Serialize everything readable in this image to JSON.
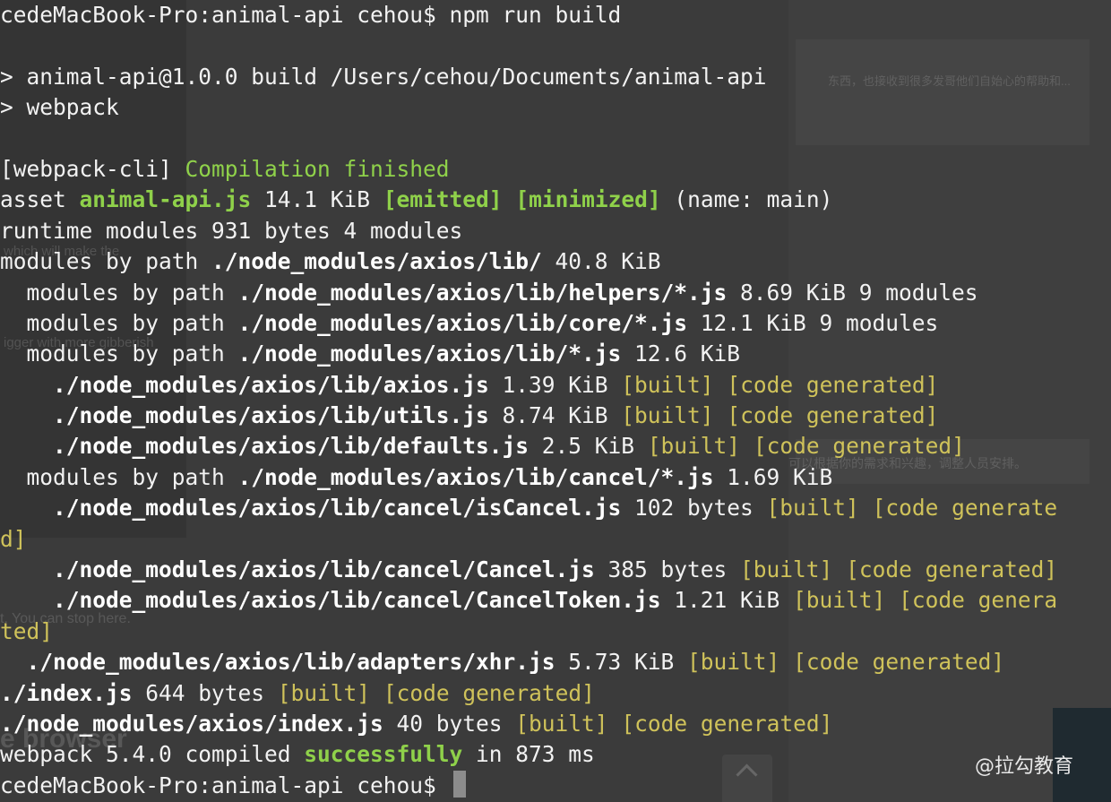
{
  "terminal": {
    "lines": [
      [
        {
          "t": "cedeMacBook-Pro:animal-api cehou$ npm run build",
          "c": ""
        }
      ],
      [
        {
          "t": "",
          "c": ""
        }
      ],
      [
        {
          "t": "> animal-api@1.0.0 build /Users/cehou/Documents/animal-api",
          "c": ""
        }
      ],
      [
        {
          "t": "> webpack",
          "c": ""
        }
      ],
      [
        {
          "t": "",
          "c": ""
        }
      ],
      [
        {
          "t": "[webpack-cli] ",
          "c": ""
        },
        {
          "t": "Compilation finished",
          "c": "green"
        }
      ],
      [
        {
          "t": "asset ",
          "c": ""
        },
        {
          "t": "animal-api.js",
          "c": "bgreen"
        },
        {
          "t": " 14.1 KiB ",
          "c": ""
        },
        {
          "t": "[emitted]",
          "c": "bgreen"
        },
        {
          "t": " ",
          "c": ""
        },
        {
          "t": "[minimized]",
          "c": "bgreen"
        },
        {
          "t": " (name: main)",
          "c": ""
        }
      ],
      [
        {
          "t": "runtime modules 931 bytes 4 modules",
          "c": ""
        }
      ],
      [
        {
          "t": "modules by path ",
          "c": ""
        },
        {
          "t": "./node_modules/axios/lib/",
          "c": "bold"
        },
        {
          "t": " 40.8 KiB",
          "c": ""
        }
      ],
      [
        {
          "t": "  modules by path ",
          "c": ""
        },
        {
          "t": "./node_modules/axios/lib/helpers/*.js",
          "c": "bold"
        },
        {
          "t": " 8.69 KiB 9 modules",
          "c": ""
        }
      ],
      [
        {
          "t": "  modules by path ",
          "c": ""
        },
        {
          "t": "./node_modules/axios/lib/core/*.js",
          "c": "bold"
        },
        {
          "t": " 12.1 KiB 9 modules",
          "c": ""
        }
      ],
      [
        {
          "t": "  modules by path ",
          "c": ""
        },
        {
          "t": "./node_modules/axios/lib/*.js",
          "c": "bold"
        },
        {
          "t": " 12.6 KiB",
          "c": ""
        }
      ],
      [
        {
          "t": "    ./node_modules/axios/lib/axios.js",
          "c": "bold"
        },
        {
          "t": " 1.39 KiB ",
          "c": ""
        },
        {
          "t": "[built]",
          "c": "yellow"
        },
        {
          "t": " ",
          "c": ""
        },
        {
          "t": "[code generated]",
          "c": "yellow"
        }
      ],
      [
        {
          "t": "    ./node_modules/axios/lib/utils.js",
          "c": "bold"
        },
        {
          "t": " 8.74 KiB ",
          "c": ""
        },
        {
          "t": "[built]",
          "c": "yellow"
        },
        {
          "t": " ",
          "c": ""
        },
        {
          "t": "[code generated]",
          "c": "yellow"
        }
      ],
      [
        {
          "t": "    ./node_modules/axios/lib/defaults.js",
          "c": "bold"
        },
        {
          "t": " 2.5 KiB ",
          "c": ""
        },
        {
          "t": "[built]",
          "c": "yellow"
        },
        {
          "t": " ",
          "c": ""
        },
        {
          "t": "[code generated]",
          "c": "yellow"
        }
      ],
      [
        {
          "t": "  modules by path ",
          "c": ""
        },
        {
          "t": "./node_modules/axios/lib/cancel/*.js",
          "c": "bold"
        },
        {
          "t": " 1.69 KiB",
          "c": ""
        }
      ],
      [
        {
          "t": "    ./node_modules/axios/lib/cancel/isCancel.js",
          "c": "bold"
        },
        {
          "t": " 102 bytes ",
          "c": ""
        },
        {
          "t": "[built]",
          "c": "yellow"
        },
        {
          "t": " ",
          "c": ""
        },
        {
          "t": "[code generate",
          "c": "yellow"
        }
      ],
      [
        {
          "t": "d]",
          "c": "yellow"
        }
      ],
      [
        {
          "t": "    ./node_modules/axios/lib/cancel/Cancel.js",
          "c": "bold"
        },
        {
          "t": " 385 bytes ",
          "c": ""
        },
        {
          "t": "[built]",
          "c": "yellow"
        },
        {
          "t": " ",
          "c": ""
        },
        {
          "t": "[code generated]",
          "c": "yellow"
        }
      ],
      [
        {
          "t": "    ./node_modules/axios/lib/cancel/CancelToken.js",
          "c": "bold"
        },
        {
          "t": " 1.21 KiB ",
          "c": ""
        },
        {
          "t": "[built]",
          "c": "yellow"
        },
        {
          "t": " ",
          "c": ""
        },
        {
          "t": "[code genera",
          "c": "yellow"
        }
      ],
      [
        {
          "t": "ted]",
          "c": "yellow"
        }
      ],
      [
        {
          "t": "  ./node_modules/axios/lib/adapters/xhr.js",
          "c": "bold"
        },
        {
          "t": " 5.73 KiB ",
          "c": ""
        },
        {
          "t": "[built]",
          "c": "yellow"
        },
        {
          "t": " ",
          "c": ""
        },
        {
          "t": "[code generated]",
          "c": "yellow"
        }
      ],
      [
        {
          "t": "./index.js",
          "c": "bold"
        },
        {
          "t": " 644 bytes ",
          "c": ""
        },
        {
          "t": "[built]",
          "c": "yellow"
        },
        {
          "t": " ",
          "c": ""
        },
        {
          "t": "[code generated]",
          "c": "yellow"
        }
      ],
      [
        {
          "t": "./node_modules/axios/index.js",
          "c": "bold"
        },
        {
          "t": " 40 bytes ",
          "c": ""
        },
        {
          "t": "[built]",
          "c": "yellow"
        },
        {
          "t": " ",
          "c": ""
        },
        {
          "t": "[code generated]",
          "c": "yellow"
        }
      ],
      [
        {
          "t": "webpack 5.4.0 compiled ",
          "c": ""
        },
        {
          "t": "successfully",
          "c": "bgreen"
        },
        {
          "t": " in 873 ms",
          "c": ""
        }
      ],
      [
        {
          "t": "cedeMacBook-Pro:animal-api cehou$ ",
          "c": ""
        }
      ]
    ],
    "cursor_line": 25
  },
  "background": {
    "text_1": "东西，也接收到很多发哥他们自始心的帮助和...",
    "text_2": "which will make the",
    "text_3": "igger with more gibberish",
    "text_4": "可以根据你的需求和兴趣，调整人员安排。",
    "text_5": "t. You can stop here.",
    "text_6": "e browser",
    "icons": [
      "twitter-icon",
      "pinterest-icon",
      "vk-icon",
      "reddit-icon",
      "copy-icon"
    ]
  },
  "watermark": "@拉勾教育",
  "colors": {
    "background": "#3b3b3b",
    "text": "#f2f2f2",
    "green": "#8fd14a",
    "yellow": "#cfc25a",
    "cursor": "#8c8c8c"
  }
}
